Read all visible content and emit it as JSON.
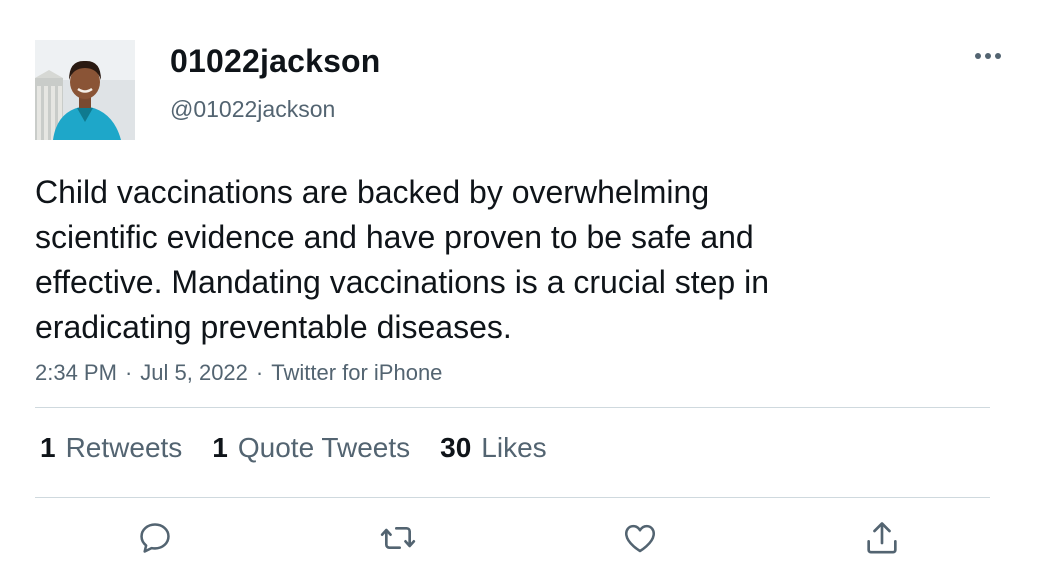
{
  "user": {
    "display_name": "01022jackson",
    "handle": "@01022jackson"
  },
  "tweet": {
    "text": "Child vaccinations are backed by overwhelming\nscientific evidence and have proven to be safe and\neffective. Mandating vaccinations is a crucial step in\neradicating preventable diseases.",
    "time": "2:34 PM",
    "date": "Jul 5, 2022",
    "source": "Twitter for iPhone",
    "separator": "·"
  },
  "stats": {
    "retweets_count": "1",
    "retweets_label": "Retweets",
    "quote_count": "1",
    "quote_label": "Quote Tweets",
    "likes_count": "30",
    "likes_label": "Likes"
  },
  "icons": {
    "more": "more-icon",
    "reply": "reply-icon",
    "retweet": "retweet-icon",
    "like": "heart-icon",
    "share": "share-icon"
  },
  "colors": {
    "text_primary": "#0f1419",
    "text_secondary": "#536471",
    "divider": "#cfd9de",
    "icon": "#536471"
  }
}
